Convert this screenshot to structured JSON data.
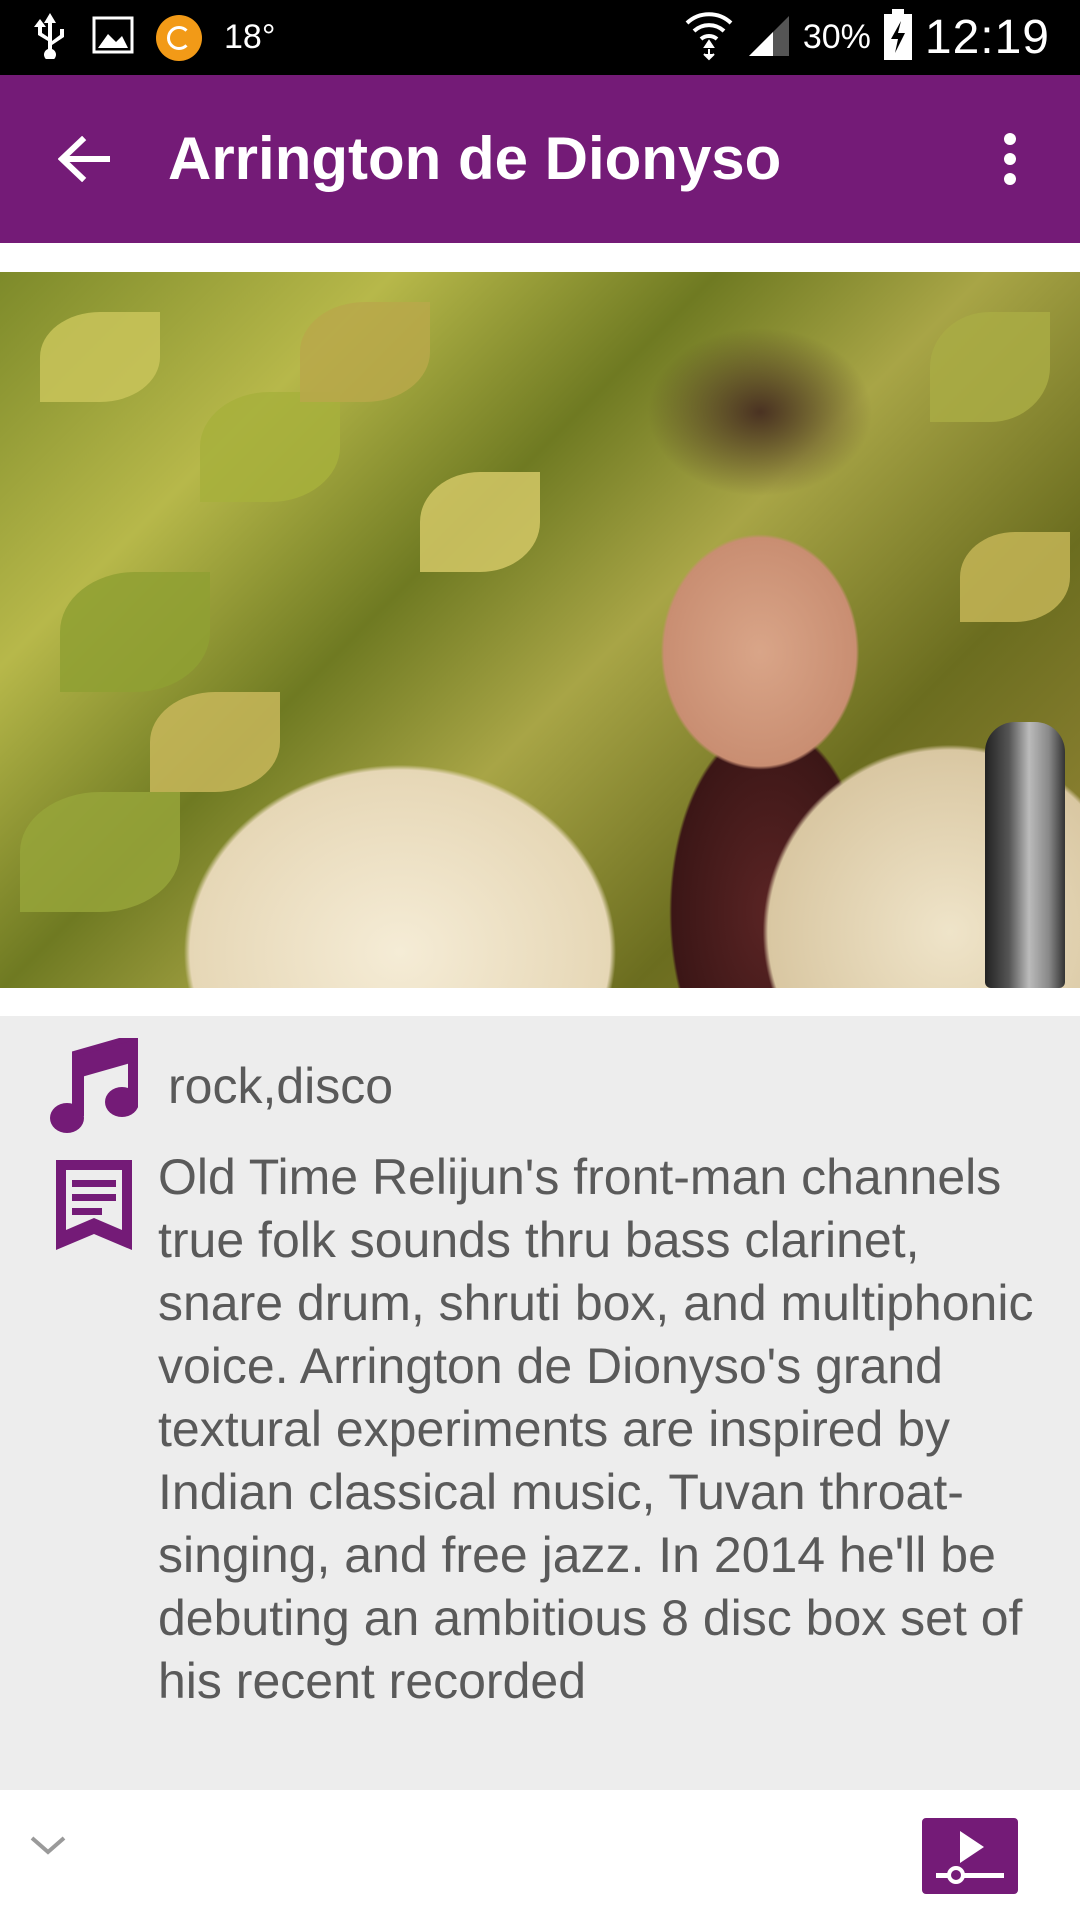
{
  "status_bar": {
    "temperature": "18°",
    "battery_percent": "30%",
    "time": "12:19",
    "icons": [
      "usb-icon",
      "image-notification-icon",
      "app-notification-icon",
      "wifi-icon",
      "signal-icon",
      "battery-charging-icon"
    ]
  },
  "app_bar": {
    "title": "Arrington de Dionyso",
    "color": "#741b77",
    "back_icon": "arrow-left-icon",
    "more_icon": "more-vert-icon"
  },
  "artist": {
    "photo_alt": "Arrington de Dionyso",
    "genre": "rock,disco",
    "description": "Old Time Relijun's front-man channels true folk sounds thru bass clarinet, snare drum, shruti box, and multiphonic voice. Arrington de Dionyso's grand textural experiments are inspired by Indian classical music, Tuvan throat-singing, and free jazz. In 2014 he'll be debuting an ambitious 8 disc box set of his recent recorded"
  },
  "bottom_bar": {
    "collapse_icon": "chevron-down-icon",
    "player_icon": "play-queue-icon"
  }
}
